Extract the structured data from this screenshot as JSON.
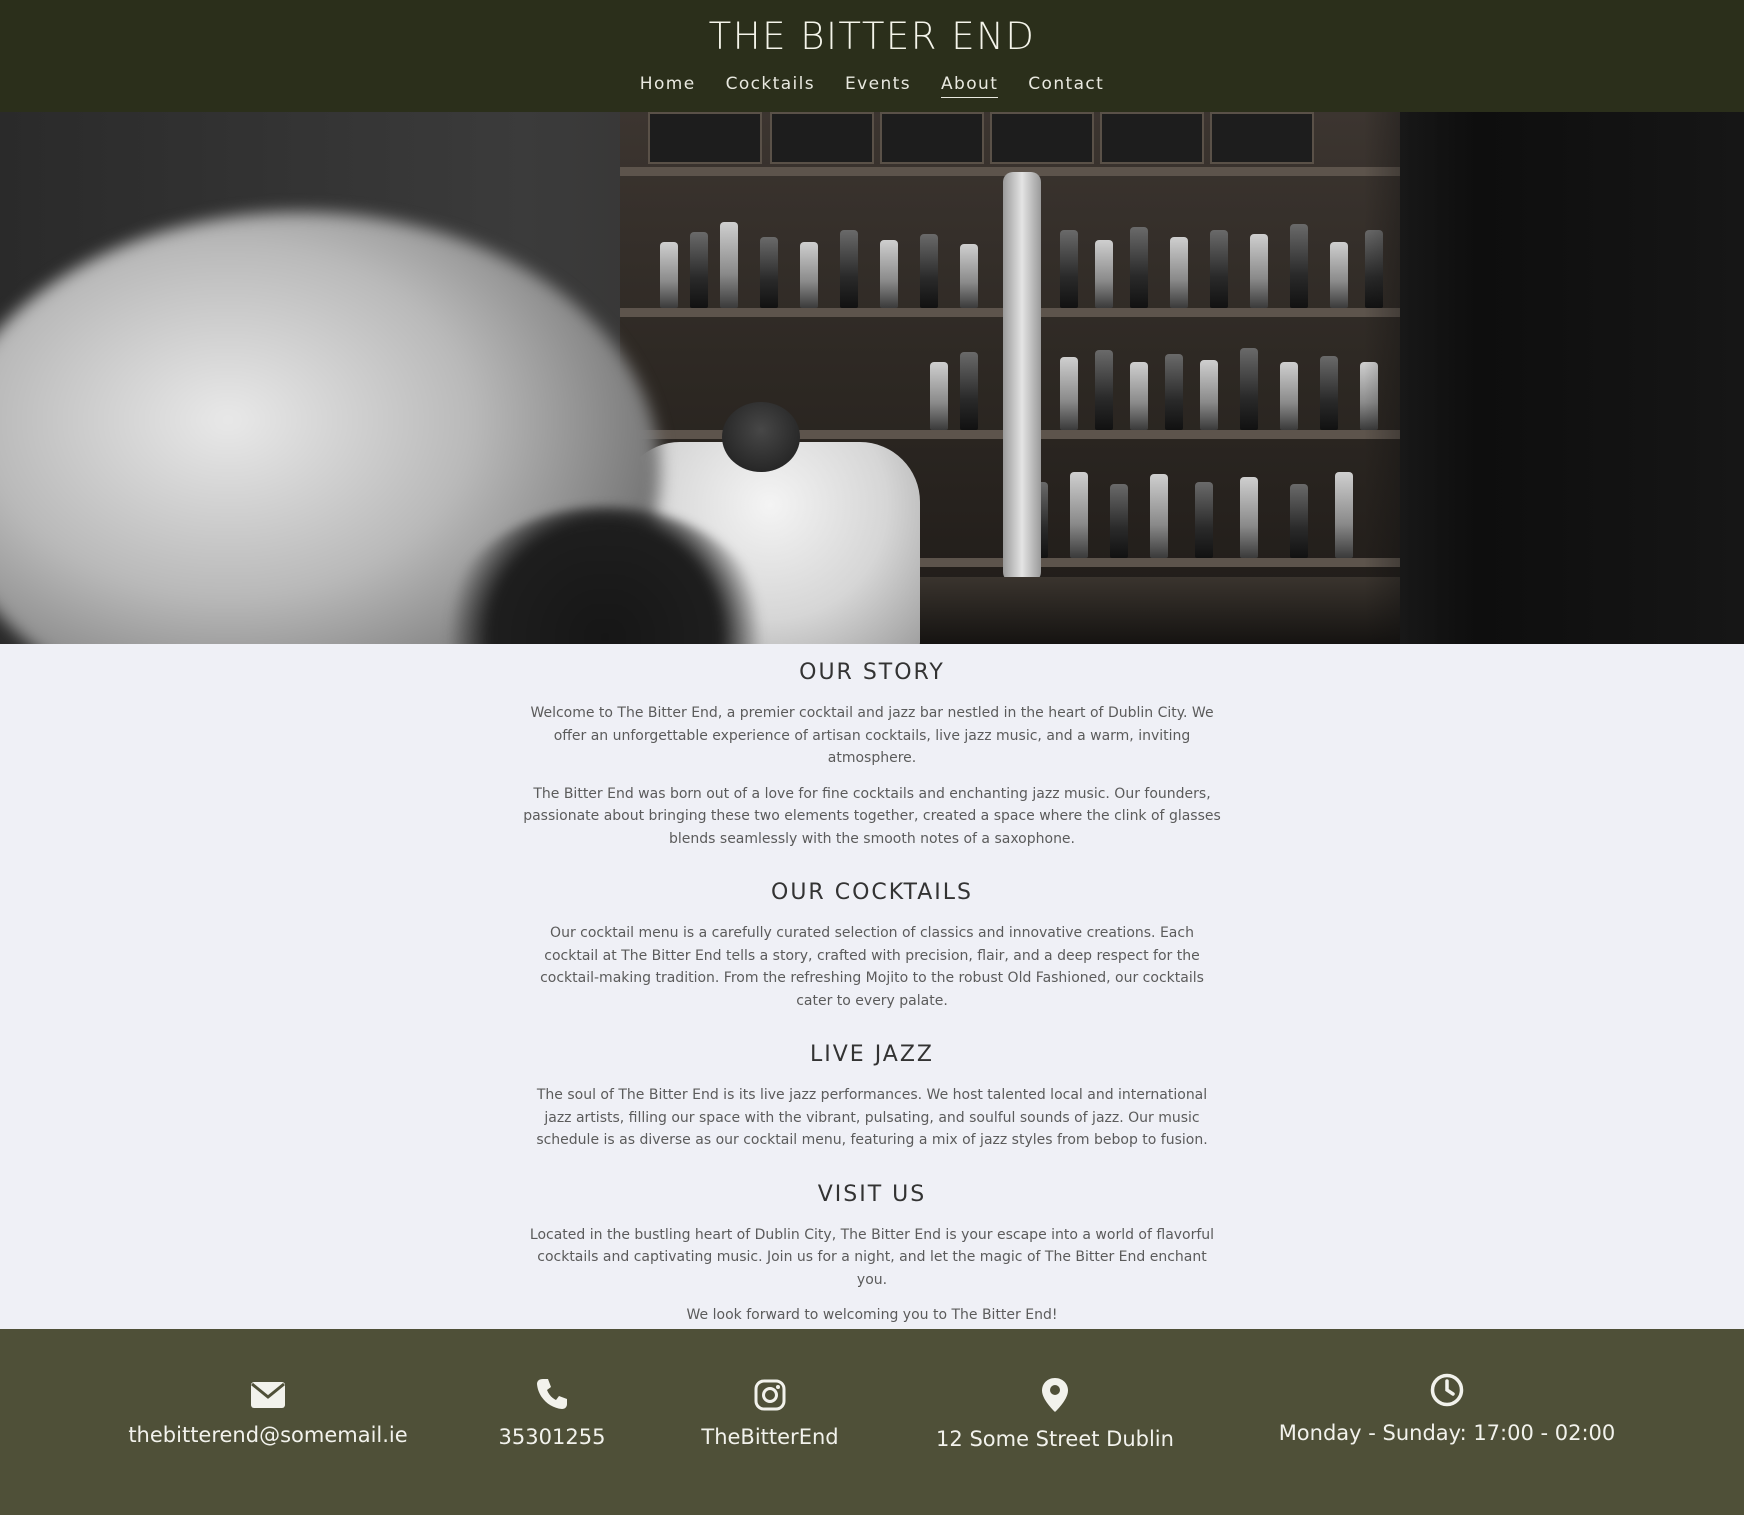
{
  "header": {
    "brand": "THE BITTER END",
    "nav": [
      "Home",
      "Cocktails",
      "Events",
      "About",
      "Contact"
    ],
    "active": "About"
  },
  "sections": [
    {
      "title": "OUR STORY",
      "paragraphs": [
        "Welcome to The Bitter End, a premier cocktail and jazz bar nestled in the heart of Dublin City. We offer an unforgettable experience of artisan cocktails, live jazz music, and a warm, inviting atmosphere.",
        "The Bitter End was born out of a love for fine cocktails and enchanting jazz music. Our founders, passionate about bringing these two elements together, created a space where the clink of glasses blends seamlessly with the smooth notes of a saxophone."
      ]
    },
    {
      "title": "OUR COCKTAILS",
      "paragraphs": [
        "Our cocktail menu is a carefully curated selection of classics and innovative creations. Each cocktail at The Bitter End tells a story, crafted with precision, flair, and a deep respect for the cocktail-making tradition. From the refreshing Mojito to the robust Old Fashioned, our cocktails cater to every palate."
      ]
    },
    {
      "title": "LIVE JAZZ",
      "paragraphs": [
        "The soul of The Bitter End is its live jazz performances. We host talented local and international jazz artists, filling our space with the vibrant, pulsating, and soulful sounds of jazz. Our music schedule is as diverse as our cocktail menu, featuring a mix of jazz styles from bebop to fusion."
      ]
    },
    {
      "title": "VISIT US",
      "paragraphs": [
        "Located in the bustling heart of Dublin City, The Bitter End is your escape into a world of flavorful cocktails and captivating music. Join us for a night, and let the magic of The Bitter End enchant you.",
        "We look forward to welcoming you to The Bitter End!"
      ]
    }
  ],
  "footer": {
    "email": {
      "icon": "envelope-icon",
      "text": "thebitterend@somemail.ie"
    },
    "phone": {
      "icon": "phone-icon",
      "text": "35301255"
    },
    "instagram": {
      "icon": "instagram-icon",
      "text": "TheBitterEnd"
    },
    "address": {
      "icon": "map-pin-icon",
      "text": "12 Some Street Dublin"
    },
    "hours": {
      "icon": "clock-icon",
      "text": "Monday - Sunday: 17:00 - 02:00"
    }
  },
  "colors": {
    "header_bg": "#2b2f1b",
    "footer_bg": "#4f5038",
    "page_bg": "#eff0f6"
  }
}
